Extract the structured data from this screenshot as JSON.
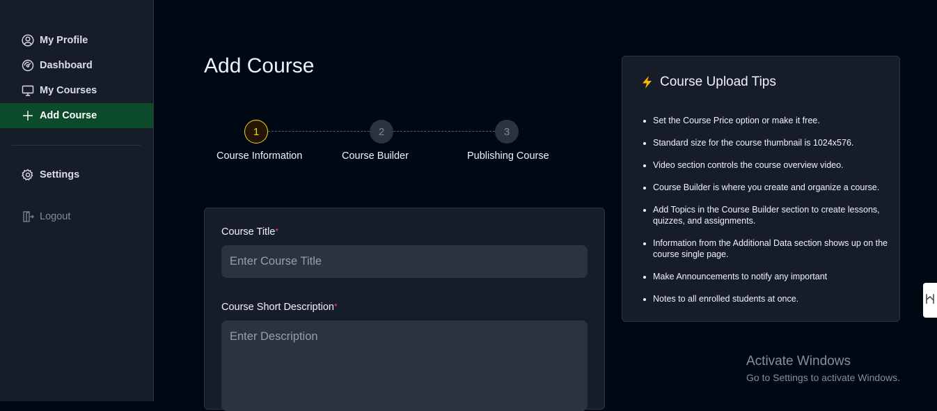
{
  "sidebar": {
    "items": [
      {
        "label": "My Profile",
        "icon": "user-circle-icon"
      },
      {
        "label": "Dashboard",
        "icon": "gauge-icon"
      },
      {
        "label": "My Courses",
        "icon": "monitor-icon"
      },
      {
        "label": "Add Course",
        "icon": "plus-icon",
        "active": true
      }
    ],
    "settings": {
      "label": "Settings",
      "icon": "gear-icon"
    },
    "logout": {
      "label": "Logout",
      "icon": "logout-icon"
    }
  },
  "main": {
    "title": "Add Course",
    "steps": [
      {
        "number": "1",
        "label": "Course Information",
        "state": "active"
      },
      {
        "number": "2",
        "label": "Course Builder",
        "state": "inactive"
      },
      {
        "number": "3",
        "label": "Publishing Course",
        "state": "inactive"
      }
    ],
    "form": {
      "title_label": "Course Title",
      "title_required": "*",
      "title_placeholder": "Enter Course Title",
      "desc_label": "Course Short Description",
      "desc_required": "*",
      "desc_placeholder": "Enter Description"
    }
  },
  "tips": {
    "title": "Course Upload Tips",
    "icon": "lightning-icon",
    "items": [
      "Set the Course Price option or make it free.",
      "Standard size for the course thumbnail is 1024x576.",
      "Video section controls the course overview video.",
      "Course Builder is where you create and organize a course.",
      "Add Topics in the Course Builder section to create lessons, quizzes, and assignments.",
      "Information from the Additional Data section shows up on the course single page.",
      "Make Announcements to notify any important",
      "Notes to all enrolled students at once."
    ]
  },
  "watermark": {
    "line1": "Activate Windows",
    "line2": "Go to Settings to activate Windows."
  },
  "colors": {
    "background": "#000814",
    "sidebar": "#161d29",
    "active_nav": "#0b4a2b",
    "accent_yellow": "#ffd60a",
    "required_red": "#ef476f"
  }
}
